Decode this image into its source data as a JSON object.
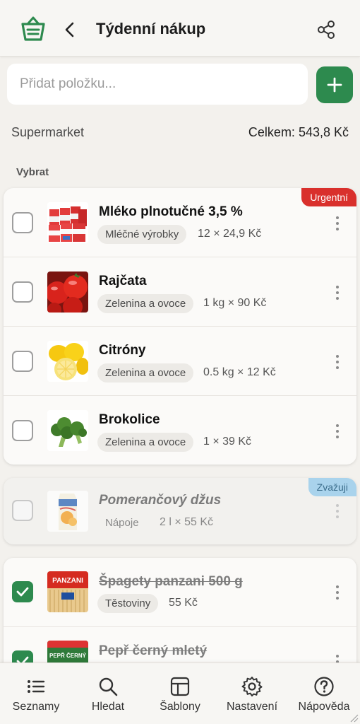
{
  "header": {
    "title": "Týdenní nákup",
    "logo_icon": "shopping-basket-icon",
    "back_icon": "chevron-left-icon",
    "share_icon": "share-icon",
    "accent": "#2d8a4e"
  },
  "add_item": {
    "placeholder": "Přidat položku...",
    "value": "",
    "button_icon": "plus-icon"
  },
  "summary": {
    "store": "Supermarket",
    "total": "Celkem: 543,8 Kč"
  },
  "section": {
    "label": "Vybrat"
  },
  "items": [
    {
      "name": "Mléko plnotučné 3,5 %",
      "category": "Mléčné výrobky",
      "quantity": "12 × 24,9 Kč",
      "checked": false,
      "badge": "Urgentní",
      "image": "milk-cartons"
    },
    {
      "name": "Rajčata",
      "category": "Zelenina a ovoce",
      "quantity": "1 kg × 90 Kč",
      "checked": false,
      "badge": "",
      "image": "tomatoes"
    },
    {
      "name": "Citróny",
      "category": "Zelenina a ovoce",
      "quantity": "0.5 kg × 12 Kč",
      "checked": false,
      "badge": "",
      "image": "lemons"
    },
    {
      "name": "Brokolice",
      "category": "Zelenina a ovoce",
      "quantity": "1 × 39 Kč",
      "checked": false,
      "badge": "",
      "image": "broccoli"
    }
  ],
  "considering": [
    {
      "name": "Pomerančový džus",
      "category": "Nápoje",
      "quantity": "2 l × 55 Kč",
      "checked": false,
      "badge": "Zvažuji",
      "image": "orange-juice-carton"
    }
  ],
  "done": [
    {
      "name": "Špagety panzani 500 g",
      "category": "Těstoviny",
      "quantity": "55 Kč",
      "checked": true,
      "image": "panzani-spaghetti",
      "image_text": "PANZANI"
    },
    {
      "name": "Pepř černý mletý",
      "checked": true,
      "image": "black-pepper-package",
      "image_text": "PEPŘ ČERNÝ"
    }
  ],
  "nav": [
    {
      "label": "Seznamy",
      "icon": "list-icon"
    },
    {
      "label": "Hledat",
      "icon": "search-icon"
    },
    {
      "label": "Šablony",
      "icon": "template-icon"
    },
    {
      "label": "Nastavení",
      "icon": "gear-icon"
    },
    {
      "label": "Nápověda",
      "icon": "help-icon"
    }
  ],
  "colors": {
    "urgent": "#d9302c",
    "consider": "#a9d3ec",
    "checked": "#2d8a4e"
  }
}
